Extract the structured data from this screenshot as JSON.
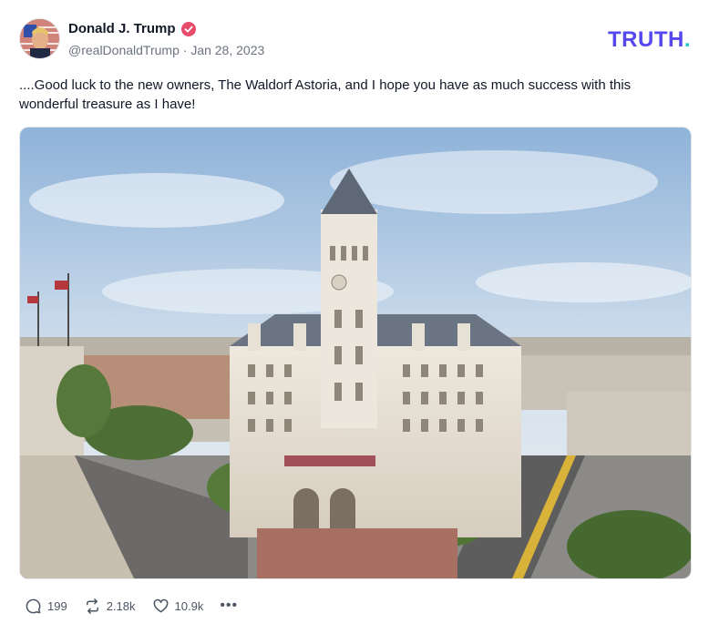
{
  "post": {
    "author": {
      "display_name": "Donald J. Trump",
      "verified": true,
      "handle": "@realDonaldTrump",
      "separator": "·",
      "date": "Jan 28, 2023"
    },
    "logo": {
      "text": "TRUTH",
      "dot": "."
    },
    "text": "....Good luck to the new owners, The Waldorf Astoria, and I hope you have as much success with this wonderful treasure as I have!",
    "media": {
      "icon": "photo-of-old-post-office-building"
    },
    "actions": {
      "replies": "199",
      "retruths": "2.18k",
      "likes": "10.9k",
      "more": "•••"
    }
  },
  "colors": {
    "brand": "#5448ee",
    "brand_dot": "#22c7c9",
    "verified": "#e84c6b",
    "muted": "#6b7280"
  }
}
